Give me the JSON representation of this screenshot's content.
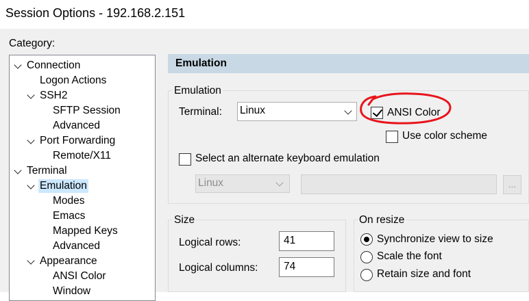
{
  "window": {
    "title": "Session Options - 192.168.2.151"
  },
  "category_label": "Category:",
  "tree": [
    {
      "label": "Connection",
      "expanded": true
    },
    {
      "label": "Logon Actions"
    },
    {
      "label": "SSH2",
      "expanded": true
    },
    {
      "label": "SFTP Session"
    },
    {
      "label": "Advanced"
    },
    {
      "label": "Port Forwarding",
      "expanded": true
    },
    {
      "label": "Remote/X11"
    },
    {
      "label": "Terminal",
      "expanded": true
    },
    {
      "label": "Emulation",
      "expanded": true,
      "selected": true
    },
    {
      "label": "Modes"
    },
    {
      "label": "Emacs"
    },
    {
      "label": "Mapped Keys"
    },
    {
      "label": "Advanced"
    },
    {
      "label": "Appearance",
      "expanded": true
    },
    {
      "label": "ANSI Color"
    },
    {
      "label": "Window"
    }
  ],
  "panel": {
    "header": "Emulation",
    "emulation_group": {
      "label": "Emulation",
      "terminal_label": "Terminal:",
      "terminal_value": "Linux",
      "ansi_color_label": "ANSI Color",
      "ansi_color_checked": true,
      "use_color_scheme_label": "Use color scheme",
      "use_color_scheme_checked": false,
      "alt_keyboard_label": "Select an alternate keyboard emulation",
      "alt_keyboard_checked": false,
      "alt_keyboard_value": "Linux",
      "browse_label": "..."
    },
    "size_group": {
      "label": "Size",
      "rows_label": "Logical rows:",
      "rows_value": "41",
      "columns_label": "Logical columns:",
      "columns_value": "74"
    },
    "resize_group": {
      "label": "On resize",
      "options": [
        {
          "label": "Synchronize view to size",
          "selected": true
        },
        {
          "label": "Scale the font",
          "selected": false
        },
        {
          "label": "Retain size and font",
          "selected": false
        }
      ]
    }
  },
  "annotation": {
    "color": "#e8141c"
  }
}
